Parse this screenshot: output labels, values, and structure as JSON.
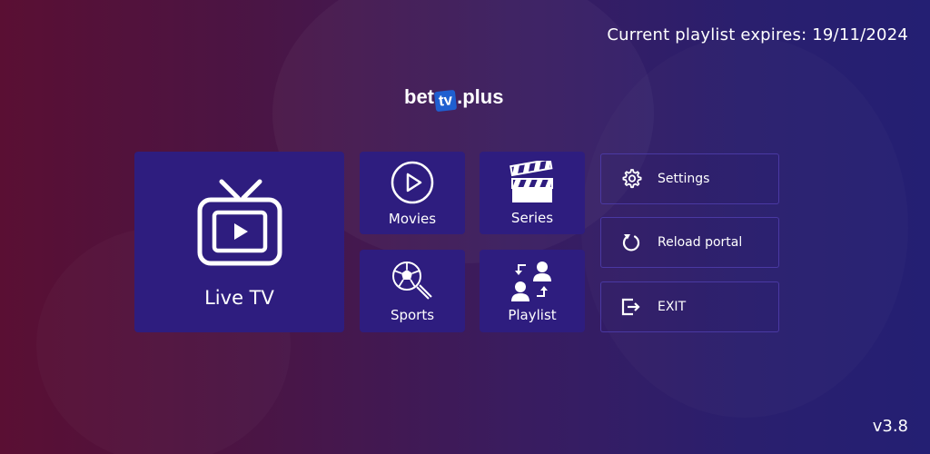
{
  "header": {
    "expiry_text": "Current playlist expires: 19/11/2024"
  },
  "logo": {
    "part1": "bet",
    "part2": "tv",
    "part3": ".plus"
  },
  "tiles": {
    "live_tv": "Live TV",
    "movies": "Movies",
    "series": "Series",
    "sports": "Sports",
    "playlist": "Playlist"
  },
  "side_menu": {
    "settings": "Settings",
    "reload": "Reload portal",
    "exit": "EXIT"
  },
  "footer": {
    "version": "v3.8"
  },
  "icons": {
    "live_tv": "tv-icon",
    "movies": "play-circle-icon",
    "series": "clapperboard-icon",
    "sports": "soccer-ball-icon",
    "playlist": "switch-users-icon",
    "settings": "gear-icon",
    "reload": "reload-icon",
    "exit": "exit-icon"
  },
  "colors": {
    "tile_bg": "#2e1d7f",
    "logo_accent": "#1f5fd0"
  }
}
